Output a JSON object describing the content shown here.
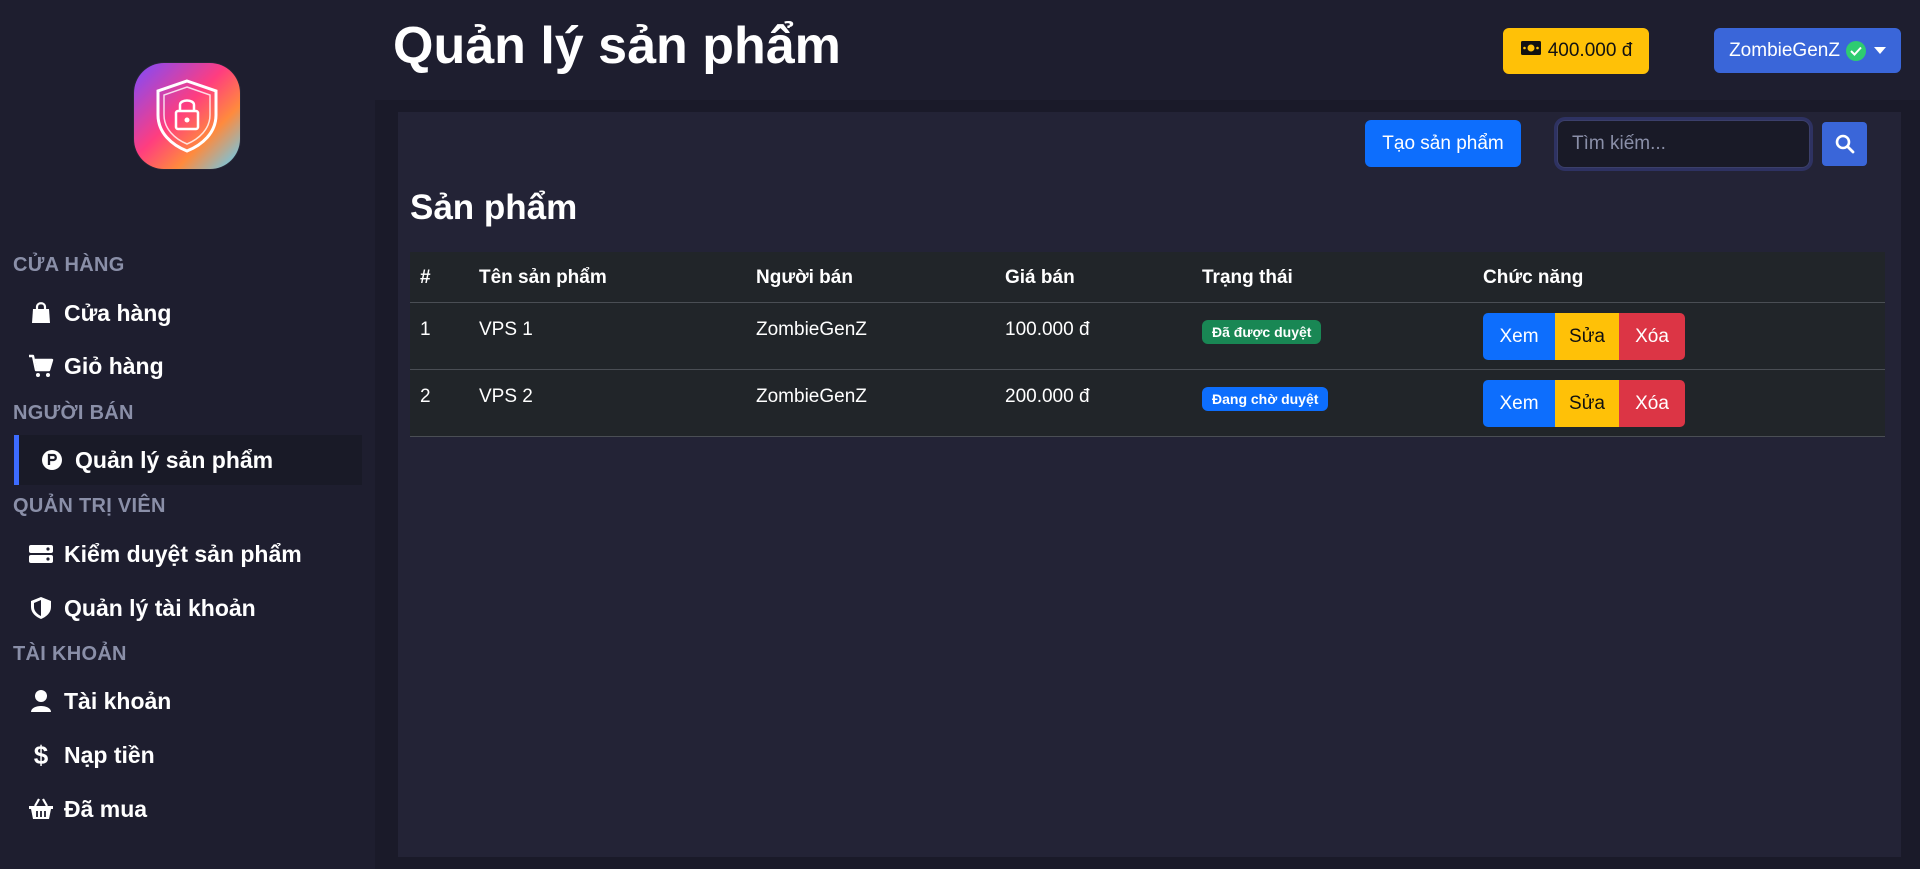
{
  "sidebar": {
    "sections": [
      {
        "label": "CỬA HÀNG"
      },
      {
        "label": "NGƯỜI BÁN"
      },
      {
        "label": "QUẢN TRỊ VIÊN"
      },
      {
        "label": "TÀI KHOẢN"
      }
    ],
    "items": [
      {
        "label": "Cửa hàng",
        "icon": "shopping-bag-icon"
      },
      {
        "label": "Giỏ hàng",
        "icon": "cart-icon"
      },
      {
        "label": "Quản lý sản phẩm",
        "icon": "product-hunt-icon",
        "active": true
      },
      {
        "label": "Kiểm duyệt sản phẩm",
        "icon": "server-icon"
      },
      {
        "label": "Quản lý tài khoản",
        "icon": "shield-icon"
      },
      {
        "label": "Tài khoản",
        "icon": "user-icon"
      },
      {
        "label": "Nạp tiền",
        "icon": "dollar-icon"
      },
      {
        "label": "Đã mua",
        "icon": "basket-icon"
      }
    ]
  },
  "header": {
    "title": "Quản lý sản phẩm",
    "balance": "400.000 đ",
    "username": "ZombieGenZ"
  },
  "toolbar": {
    "create_label": "Tạo sản phẩm",
    "search_placeholder": "Tìm kiếm..."
  },
  "main": {
    "section_title": "Sản phẩm",
    "columns": [
      "#",
      "Tên sản phẩm",
      "Người bán",
      "Giá bán",
      "Trạng thái",
      "Chức năng"
    ],
    "rows": [
      {
        "index": "1",
        "name": "VPS 1",
        "seller": "ZombieGenZ",
        "price": "100.000 đ",
        "status": "Đã được duyệt",
        "status_type": "success",
        "view": "Xem",
        "edit": "Sửa",
        "delete": "Xóa"
      },
      {
        "index": "2",
        "name": "VPS 2",
        "seller": "ZombieGenZ",
        "price": "200.000 đ",
        "status": "Đang chờ duyệt",
        "status_type": "primary",
        "view": "Xem",
        "edit": "Sửa",
        "delete": "Xóa"
      }
    ]
  },
  "colors": {
    "background": "#1e1e2f",
    "card": "#232336",
    "primary": "#0d6efd",
    "warning": "#ffc107",
    "danger": "#dc3545",
    "success": "#198754",
    "user_button": "#3a66d9"
  }
}
